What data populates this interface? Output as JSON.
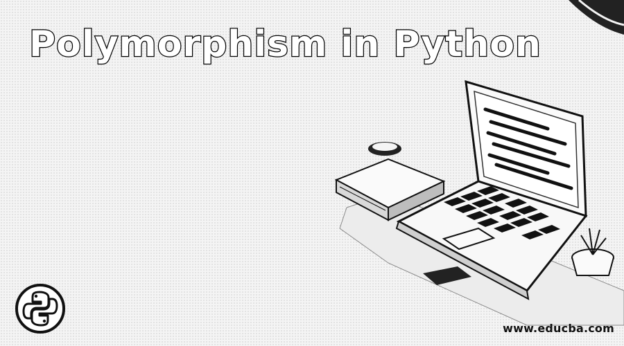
{
  "banner": {
    "title": "Polymorphism in Python",
    "website": "www.educba.com",
    "logo_icon": "python-logo-icon",
    "illustration_icon": "laptop-with-book-and-plant-icon",
    "colors": {
      "background": "#f4f4f4",
      "title_fill": "#ffffff",
      "title_outline": "#000000",
      "ink": "#111111"
    }
  }
}
